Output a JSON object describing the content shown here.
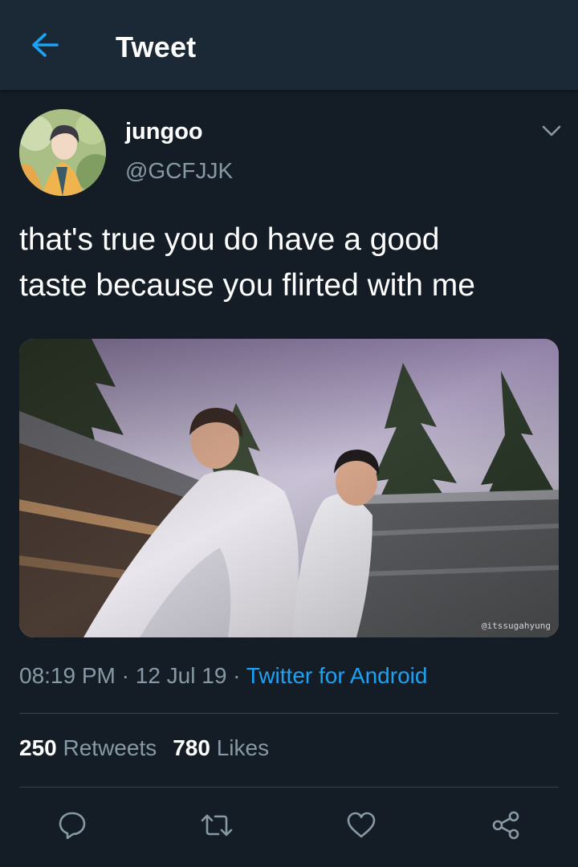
{
  "header": {
    "title": "Tweet",
    "back_icon": "arrow-left-icon"
  },
  "tweet": {
    "display_name": "jungoo",
    "handle": "@GCFJJK",
    "text": "that's true you do have a good\ntaste because you flirted with me",
    "media_watermark": "@itssugahyung",
    "time": "08:19 PM",
    "date": "12 Jul 19",
    "separator": "·",
    "source": "Twitter for Android",
    "retweets_count": "250",
    "retweets_label": "Retweets",
    "likes_count": "780",
    "likes_label": "Likes"
  },
  "actions": [
    "reply-icon",
    "retweet-icon",
    "like-icon",
    "share-icon"
  ],
  "colors": {
    "background": "#141d26",
    "header_bg": "#1b2836",
    "accent": "#1da1f2",
    "secondary_text": "#8899a6",
    "divider": "#38444d"
  }
}
